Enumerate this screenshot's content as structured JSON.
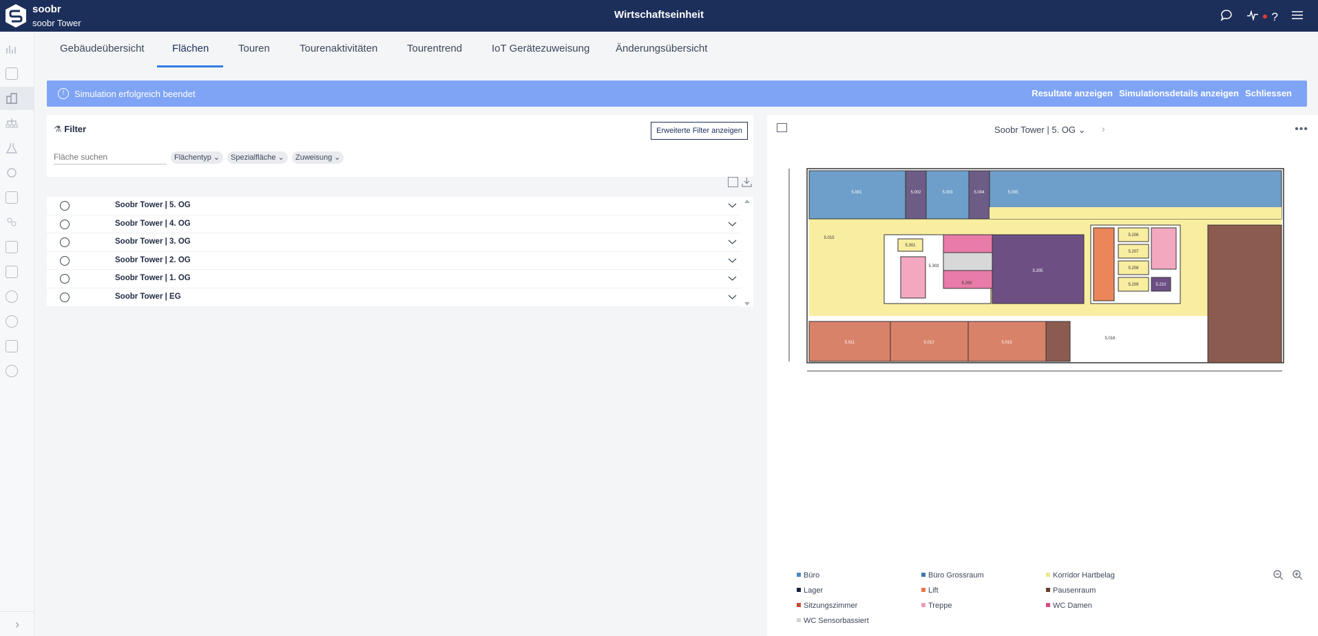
{
  "header": {
    "brand": "soobr",
    "subtitle": "soobr Tower",
    "title": "Wirtschaftseinheit",
    "icons": [
      "chat-icon",
      "activity-icon",
      "help-icon",
      "menu-icon"
    ]
  },
  "sidebar": {
    "icons": [
      "chart-icon",
      "dollar-icon",
      "building-icon",
      "org-chart-icon",
      "flask-icon",
      "sync-icon",
      "calendar-icon",
      "users-icon",
      "report-icon",
      "book-icon",
      "target-icon",
      "info-icon",
      "translate-icon",
      "settings-icon"
    ],
    "expand_icon": "chevron-right-icon"
  },
  "tabs": [
    {
      "label": "Gebäudeübersicht"
    },
    {
      "label": "Flächen"
    },
    {
      "label": "Touren"
    },
    {
      "label": "Tourenaktivitäten"
    },
    {
      "label": "Tourentrend"
    },
    {
      "label": "IoT Gerätezuweisung"
    },
    {
      "label": "Änderungsübersicht"
    }
  ],
  "banner": {
    "message": "Simulation erfolgreich beendet",
    "actions": [
      "Resultate anzeigen",
      "Simulationsdetails anzeigen",
      "Schliessen"
    ],
    "color": "#7fa4f5"
  },
  "filter": {
    "title": "Filter",
    "advanced_button": "Erweiterte Filter anzeigen",
    "search_placeholder": "Fläche suchen",
    "chips": [
      "Flächentyp",
      "Spezialfläche",
      "Zuweisung"
    ]
  },
  "floors": [
    {
      "label": "Soobr Tower | 5. OG"
    },
    {
      "label": "Soobr Tower | 4. OG"
    },
    {
      "label": "Soobr Tower | 3. OG"
    },
    {
      "label": "Soobr Tower | 2. OG"
    },
    {
      "label": "Soobr Tower | 1. OG"
    },
    {
      "label": "Soobr Tower | EG"
    }
  ],
  "plan": {
    "selected_floor": "Soobr Tower | 5. OG",
    "rooms": [
      "5.001",
      "5.002",
      "5.003",
      "5.004",
      "5.005",
      "5.015",
      "5.301",
      "5.303",
      "5.206",
      "5.207",
      "5.208",
      "5.209",
      "5.210",
      "5.205",
      "5.200",
      "5.011",
      "5.012",
      "5.013",
      "5.016"
    ]
  },
  "legend": [
    {
      "label": "Büro",
      "color": "#4a88c2"
    },
    {
      "label": "Büro Grossraum",
      "color": "#3f78ac"
    },
    {
      "label": "Korridor Hartbelag",
      "color": "#f3e58a"
    },
    {
      "label": "Lager",
      "color": "#1a2240"
    },
    {
      "label": "Lift",
      "color": "#e8764a"
    },
    {
      "label": "Pausenraum",
      "color": "#6a3d2c"
    },
    {
      "label": "Sitzungszimmer",
      "color": "#c74a36"
    },
    {
      "label": "Treppe",
      "color": "#f29bb5"
    },
    {
      "label": "WC Damen",
      "color": "#e0478a"
    },
    {
      "label": "WC Sensorbassiert",
      "color": "#d4d4d4"
    }
  ],
  "zoom_icons": [
    "zoom-out-icon",
    "zoom-in-icon"
  ]
}
